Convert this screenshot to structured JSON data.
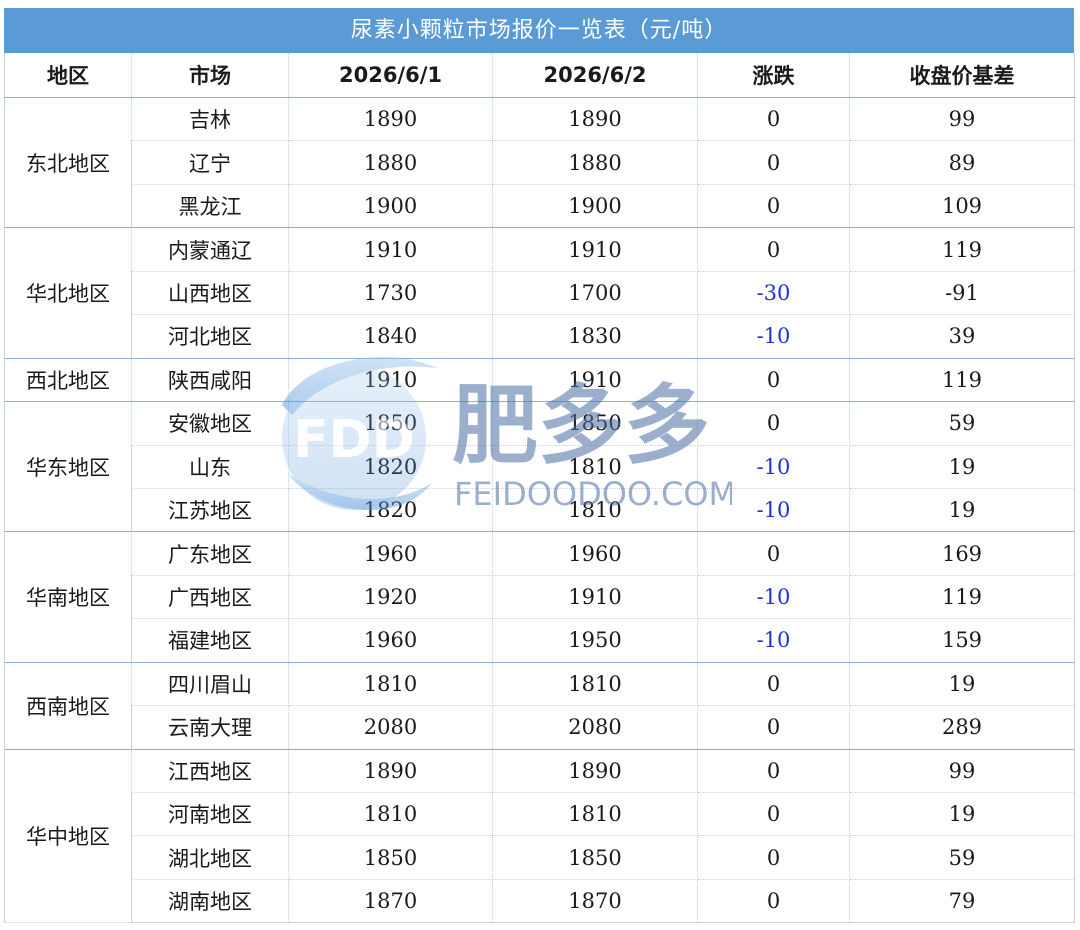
{
  "title": "尿素小颗粒市场报价一览表（元/吨）",
  "headers": [
    "地区",
    "市场",
    "2026/6/1",
    "2026/6/2",
    "涨跌",
    "收盘价基差"
  ],
  "groups": [
    {
      "region": "东北地区",
      "rows": [
        {
          "market": "吉林",
          "d1": "1890",
          "d2": "1890",
          "change": "0",
          "basis": "99"
        },
        {
          "market": "辽宁",
          "d1": "1880",
          "d2": "1880",
          "change": "0",
          "basis": "89"
        },
        {
          "market": "黑龙江",
          "d1": "1900",
          "d2": "1900",
          "change": "0",
          "basis": "109"
        }
      ]
    },
    {
      "region": "华北地区",
      "rows": [
        {
          "market": "内蒙通辽",
          "d1": "1910",
          "d2": "1910",
          "change": "0",
          "basis": "119"
        },
        {
          "market": "山西地区",
          "d1": "1730",
          "d2": "1700",
          "change": "-30",
          "basis": "-91"
        },
        {
          "market": "河北地区",
          "d1": "1840",
          "d2": "1830",
          "change": "-10",
          "basis": "39"
        }
      ]
    },
    {
      "region": "西北地区",
      "rows": [
        {
          "market": "陕西咸阳",
          "d1": "1910",
          "d2": "1910",
          "change": "0",
          "basis": "119"
        }
      ]
    },
    {
      "region": "华东地区",
      "rows": [
        {
          "market": "安徽地区",
          "d1": "1850",
          "d2": "1850",
          "change": "0",
          "basis": "59"
        },
        {
          "market": "山东",
          "d1": "1820",
          "d2": "1810",
          "change": "-10",
          "basis": "19"
        },
        {
          "market": "江苏地区",
          "d1": "1820",
          "d2": "1810",
          "change": "-10",
          "basis": "19"
        }
      ]
    },
    {
      "region": "华南地区",
      "rows": [
        {
          "market": "广东地区",
          "d1": "1960",
          "d2": "1960",
          "change": "0",
          "basis": "169"
        },
        {
          "market": "广西地区",
          "d1": "1920",
          "d2": "1910",
          "change": "-10",
          "basis": "119"
        },
        {
          "market": "福建地区",
          "d1": "1960",
          "d2": "1950",
          "change": "-10",
          "basis": "159"
        }
      ]
    },
    {
      "region": "西南地区",
      "rows": [
        {
          "market": "四川眉山",
          "d1": "1810",
          "d2": "1810",
          "change": "0",
          "basis": "19"
        },
        {
          "market": "云南大理",
          "d1": "2080",
          "d2": "2080",
          "change": "0",
          "basis": "289"
        }
      ]
    },
    {
      "region": "华中地区",
      "rows": [
        {
          "market": "江西地区",
          "d1": "1890",
          "d2": "1890",
          "change": "0",
          "basis": "99"
        },
        {
          "market": "河南地区",
          "d1": "1810",
          "d2": "1810",
          "change": "0",
          "basis": "19"
        },
        {
          "market": "湖北地区",
          "d1": "1850",
          "d2": "1850",
          "change": "0",
          "basis": "59"
        },
        {
          "market": "湖南地区",
          "d1": "1870",
          "d2": "1870",
          "change": "0",
          "basis": "79"
        }
      ]
    }
  ],
  "watermark": {
    "logo_text": "FDD",
    "brand_text": "肥多多",
    "url_text": "FEIDOODOO.COM",
    "logo_color": "#5b9bd5",
    "brand_color": "#4a6fa5"
  },
  "colors": {
    "title_bg": "#5b9bd5",
    "title_text": "#ffffff",
    "negative_change": "#1f33d6"
  }
}
